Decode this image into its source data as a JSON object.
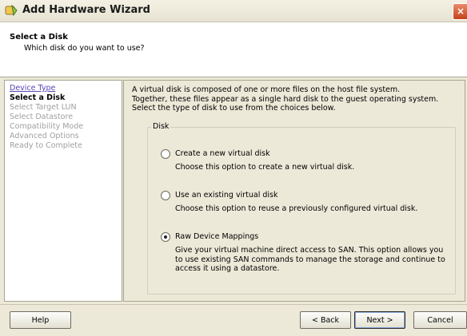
{
  "window": {
    "title": "Add Hardware Wizard",
    "close_symbol": "×"
  },
  "header": {
    "title": "Select a Disk",
    "subtitle": "Which disk do you want to use?"
  },
  "nav": {
    "items": [
      {
        "label": "Device Type",
        "state": "link"
      },
      {
        "label": "Select a Disk",
        "state": "current"
      },
      {
        "label": "Select Target LUN",
        "state": "disabled"
      },
      {
        "label": "Select Datastore",
        "state": "disabled"
      },
      {
        "label": "Compatibility Mode",
        "state": "disabled"
      },
      {
        "label": "Advanced Options",
        "state": "disabled"
      },
      {
        "label": "Ready to Complete",
        "state": "disabled"
      }
    ]
  },
  "intro": {
    "lines": [
      "A virtual disk is composed of one or more files on the host file system.",
      "Together, these files appear as a single hard disk to the guest operating system.",
      "Select the type of disk to use from the choices below."
    ]
  },
  "disk_group": {
    "legend": "Disk",
    "options": [
      {
        "label": "Create a new virtual disk",
        "checked": false,
        "desc": [
          "Choose this option to create a new virtual disk."
        ]
      },
      {
        "label": "Use an existing virtual disk",
        "checked": false,
        "desc": [
          "Choose this option to reuse a previously configured virtual disk."
        ]
      },
      {
        "label": "Raw Device Mappings",
        "checked": true,
        "desc": [
          "Give your virtual machine direct access to SAN. This option allows you",
          "to use existing SAN commands to manage the storage and continue to",
          "access it using a datastore."
        ]
      }
    ]
  },
  "footer": {
    "help": "Help",
    "back": "< Back",
    "next": "Next >",
    "cancel": "Cancel"
  }
}
